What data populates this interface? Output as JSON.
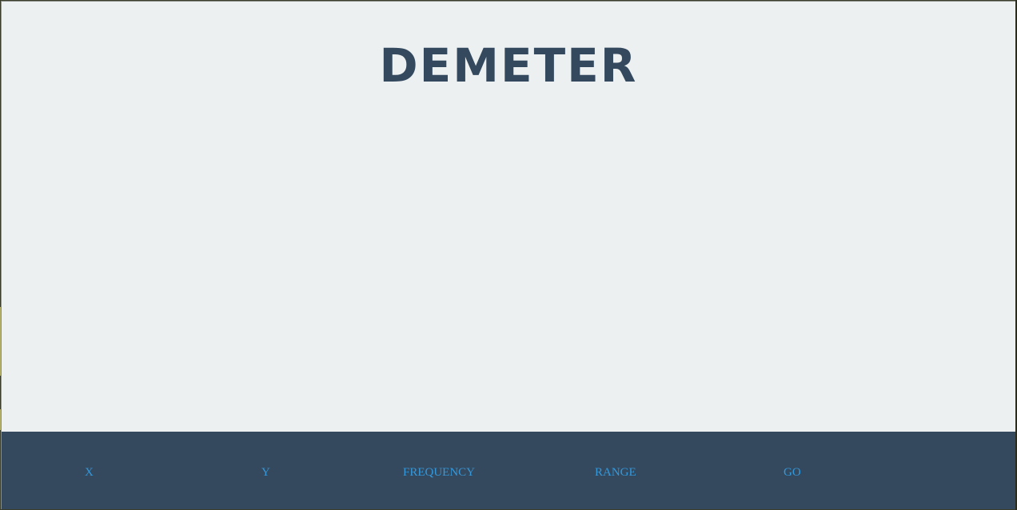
{
  "app": {
    "title": "DEMETER"
  },
  "footer": {
    "items": [
      {
        "label": "X"
      },
      {
        "label": "Y"
      },
      {
        "label": "FREQUENCY"
      },
      {
        "label": "RANGE"
      },
      {
        "label": "GO"
      }
    ]
  },
  "colors": {
    "background": "#ecf0f1",
    "title": "#34495e",
    "footer_bg": "#34495e",
    "footer_text": "#3498db"
  }
}
